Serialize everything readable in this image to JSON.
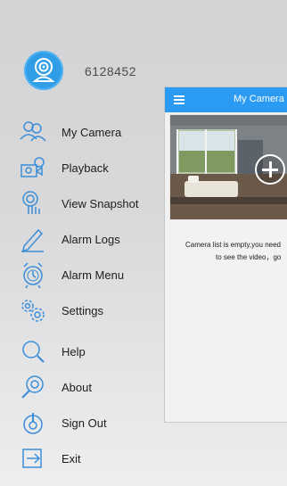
{
  "profile": {
    "username": "6128452"
  },
  "menu": {
    "items": [
      {
        "label": "My Camera",
        "icon": "people-icon"
      },
      {
        "label": "Playback",
        "icon": "camera-playback-icon"
      },
      {
        "label": "View Snapshot",
        "icon": "snapshot-icon"
      },
      {
        "label": "Alarm Logs",
        "icon": "pencil-icon"
      },
      {
        "label": "Alarm Menu",
        "icon": "alarm-clock-icon"
      },
      {
        "label": "Settings",
        "icon": "gear-icon"
      },
      {
        "label": "Help",
        "icon": "search-help-icon"
      },
      {
        "label": "About",
        "icon": "about-icon"
      },
      {
        "label": "Sign Out",
        "icon": "power-icon"
      },
      {
        "label": "Exit",
        "icon": "exit-icon"
      }
    ]
  },
  "panel": {
    "title": "My Camera",
    "empty_line1": "Camera list is empty,you need",
    "empty_line2": "to see the video，go"
  },
  "colors": {
    "accent": "#2b9af3",
    "avatar": "#2f9ee7",
    "icon_blue": "#3c8ed8"
  }
}
